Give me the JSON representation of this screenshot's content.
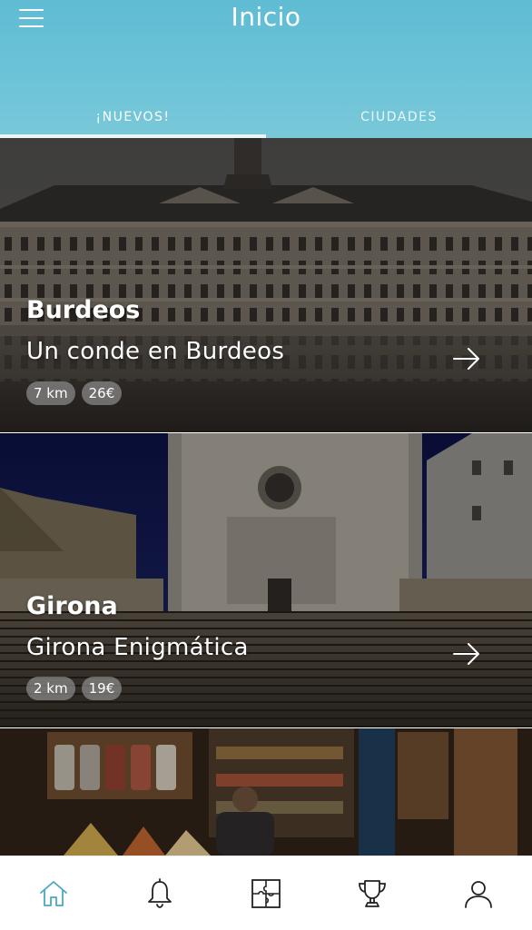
{
  "header": {
    "title": "Inicio",
    "menu_icon": "hamburger-menu-icon",
    "background": "#6cc3d8"
  },
  "tabs": [
    {
      "label": "¡NUEVOS!",
      "active": true
    },
    {
      "label": "CIUDADES",
      "active": false
    }
  ],
  "routes": [
    {
      "city": "Burdeos",
      "title": "Un conde en Burdeos",
      "distance": "7 km",
      "price": "26€",
      "arrow_icon": "arrow-right-icon"
    },
    {
      "city": "Girona",
      "title": "Girona Enigmática",
      "distance": "2 km",
      "price": "19€",
      "arrow_icon": "arrow-right-icon"
    },
    {
      "city": "",
      "title": "",
      "distance": "",
      "price": ""
    }
  ],
  "bottom_nav": [
    {
      "icon": "home-icon",
      "active": true
    },
    {
      "icon": "bell-icon",
      "active": false
    },
    {
      "icon": "puzzle-icon",
      "active": false
    },
    {
      "icon": "trophy-icon",
      "active": false
    },
    {
      "icon": "user-icon",
      "active": false
    }
  ],
  "colors": {
    "accent": "#4aa7c2",
    "nav_icon": "#222222",
    "badge_bg": "#8c8c8c"
  }
}
